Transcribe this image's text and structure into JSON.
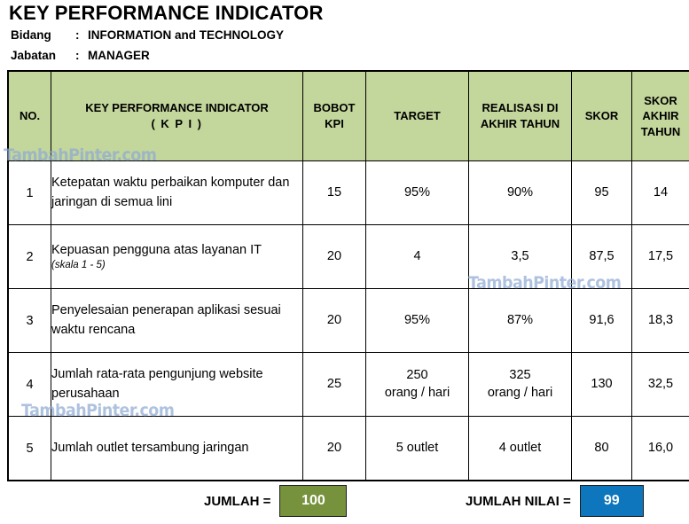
{
  "document": {
    "title": "KEY PERFORMANCE INDICATOR",
    "meta": [
      {
        "label": "Bidang",
        "colon": ":",
        "value": "INFORMATION and TECHNOLOGY"
      },
      {
        "label": "Jabatan",
        "colon": ":",
        "value": "MANAGER"
      }
    ]
  },
  "table": {
    "headers": {
      "no": "NO.",
      "kpi_line1": "KEY PERFORMANCE INDICATOR",
      "kpi_line2": "( K P I )",
      "bobot_line1": "BOBOT",
      "bobot_line2": "KPI",
      "target": "TARGET",
      "realisasi_line1": "REALISASI DI",
      "realisasi_line2": "AKHIR TAHUN",
      "skor": "SKOR",
      "skor_akhir_line1": "SKOR",
      "skor_akhir_line2": "AKHIR",
      "skor_akhir_line3": "TAHUN"
    },
    "rows": [
      {
        "no": "1",
        "kpi": "Ketepatan waktu perbaikan komputer dan jaringan di semua lini",
        "kpi_sub": "",
        "bobot": "15",
        "target": "95%",
        "target_line2": "",
        "realisasi": "90%",
        "realisasi_line2": "",
        "skor": "95",
        "skor_akhir": "14"
      },
      {
        "no": "2",
        "kpi": "Kepuasan pengguna atas layanan IT",
        "kpi_sub": "(skala 1 - 5)",
        "bobot": "20",
        "target": "4",
        "target_line2": "",
        "realisasi": "3,5",
        "realisasi_line2": "",
        "skor": "87,5",
        "skor_akhir": "17,5"
      },
      {
        "no": "3",
        "kpi": "Penyelesaian penerapan aplikasi sesuai waktu rencana",
        "kpi_sub": "",
        "bobot": "20",
        "target": "95%",
        "target_line2": "",
        "realisasi": "87%",
        "realisasi_line2": "",
        "skor": "91,6",
        "skor_akhir": "18,3"
      },
      {
        "no": "4",
        "kpi": "Jumlah rata-rata pengunjung website perusahaan",
        "kpi_sub": "",
        "bobot": "25",
        "target": "250",
        "target_line2": "orang / hari",
        "realisasi": "325",
        "realisasi_line2": "orang / hari",
        "skor": "130",
        "skor_akhir": "32,5"
      },
      {
        "no": "5",
        "kpi": "Jumlah outlet tersambung jaringan",
        "kpi_sub": "",
        "bobot": "20",
        "target": "5 outlet",
        "target_line2": "",
        "realisasi": "4 outlet",
        "realisasi_line2": "",
        "skor": "80",
        "skor_akhir": "16,0"
      }
    ]
  },
  "totals": {
    "jumlah_label": "JUMLAH =",
    "jumlah_value": "100",
    "jumlah_color": "#76923c",
    "nilai_label": "JUMLAH NILAI =",
    "nilai_value": "99",
    "nilai_color": "#0e76bc"
  },
  "watermark": {
    "text": "TambahPinter.com",
    "color": "#8fabd4"
  },
  "colors": {
    "header_fill": "#c3d69b",
    "border": "#000000",
    "body_fill": "#ffffff"
  }
}
